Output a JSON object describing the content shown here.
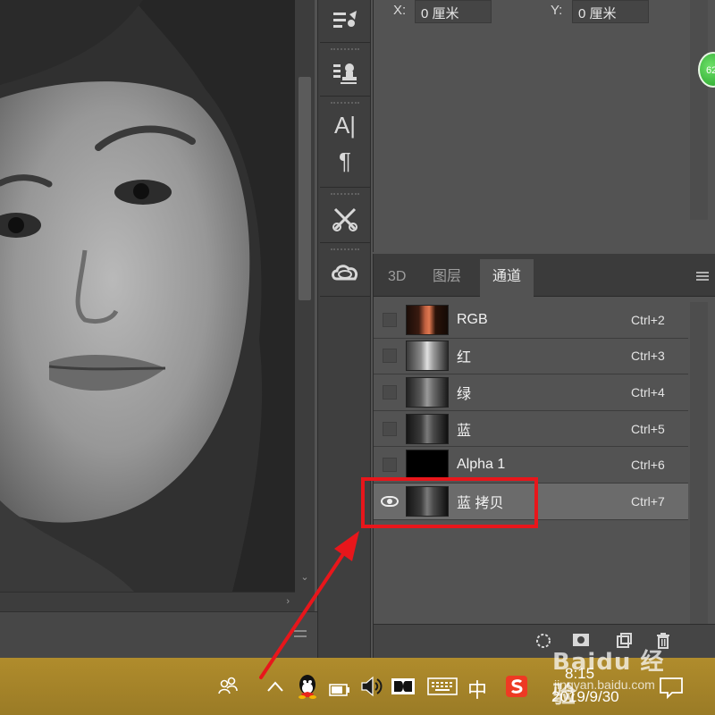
{
  "info_panel": {
    "x_label": "X:",
    "x_value": "0 厘米",
    "y_label": "Y:",
    "y_value": "0 厘米"
  },
  "badge": {
    "text": "62"
  },
  "tabs": [
    {
      "label": "3D"
    },
    {
      "label": "图层"
    },
    {
      "label": "通道",
      "active": true
    }
  ],
  "channels": [
    {
      "name": "RGB",
      "shortcut": "Ctrl+2",
      "visible": false,
      "thumb": "color"
    },
    {
      "name": "红",
      "shortcut": "Ctrl+3",
      "visible": false,
      "thumb": "gray-light"
    },
    {
      "name": "绿",
      "shortcut": "Ctrl+4",
      "visible": false,
      "thumb": "gray"
    },
    {
      "name": "蓝",
      "shortcut": "Ctrl+5",
      "visible": false,
      "thumb": "gray-dark"
    },
    {
      "name": "Alpha 1",
      "shortcut": "Ctrl+6",
      "visible": false,
      "thumb": "black"
    },
    {
      "name": "蓝 拷贝",
      "shortcut": "Ctrl+7",
      "visible": true,
      "selected": true,
      "thumb": "gray-dark"
    }
  ],
  "toolbar_icons": [
    "brush-settings-icon",
    "clone-source-icon",
    "character-icon",
    "paragraph-icon",
    "tool-presets-icon",
    "creative-cloud-icon"
  ],
  "taskbar": {
    "ime": "中",
    "time": "8:15",
    "date": "2019/9/30"
  },
  "watermark": {
    "brand": "Baidu 经验",
    "sub": "jingyan.baidu.com"
  },
  "colors": {
    "highlight": "#e8161b",
    "taskbar": "#a5852a",
    "panel": "#535353"
  }
}
